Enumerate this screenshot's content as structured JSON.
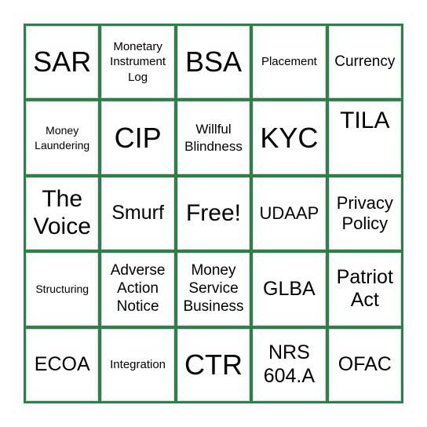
{
  "board": {
    "accent_color": "#2e8049",
    "cells": [
      {
        "text": "SAR"
      },
      {
        "text": "Monetary\nInstrument\nLog"
      },
      {
        "text": "BSA"
      },
      {
        "text": "Placement"
      },
      {
        "text": "Currency"
      },
      {
        "text": "Money\nLaundering"
      },
      {
        "text": "CIP"
      },
      {
        "text": "Willful\nBlindness"
      },
      {
        "text": "KYC"
      },
      {
        "text": "TILA"
      },
      {
        "text": "The\nVoice"
      },
      {
        "text": "Smurf"
      },
      {
        "text": "Free!",
        "free": true
      },
      {
        "text": "UDAAP"
      },
      {
        "text": "Privacy\nPolicy"
      },
      {
        "text": "Structuring"
      },
      {
        "text": "Adverse\nAction\nNotice"
      },
      {
        "text": "Money\nService\nBusiness"
      },
      {
        "text": "GLBA"
      },
      {
        "text": "Patriot\nAct"
      },
      {
        "text": "ECOA"
      },
      {
        "text": "Integration"
      },
      {
        "text": "CTR"
      },
      {
        "text": "NRS\n604.A"
      },
      {
        "text": "OFAC"
      }
    ]
  }
}
